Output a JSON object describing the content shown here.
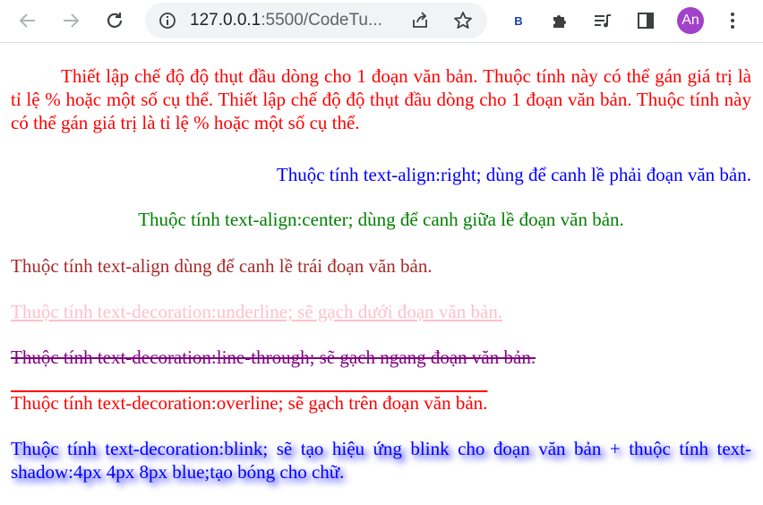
{
  "browser": {
    "url_host": "127.0.0.1",
    "url_rest": ":5500/CodeTu...",
    "ext_label": "B",
    "avatar_initials": "An",
    "icons": [
      "back-arrow-icon",
      "forward-arrow-icon",
      "reload-icon",
      "info-icon",
      "share-icon",
      "star-icon",
      "extension-b-icon",
      "puzzle-icon",
      "media-queue-icon",
      "side-panel-icon",
      "menu-dots-icon"
    ]
  },
  "paragraphs": {
    "indent": "Thiết lập chế độ độ thụt đầu dòng cho 1 đoạn văn bản. Thuộc tính này có thể gán giá trị là tỉ lệ % hoặc một số cụ thể. Thiết lập chế độ độ thụt đầu dòng cho 1 đoạn văn bản. Thuộc tính này có thể gán giá trị là tỉ lệ % hoặc một số cụ thể.",
    "right": "Thuộc tính text-align:right; dùng để canh lề phải đoạn văn bản.",
    "center": "Thuộc tính text-align:center; dùng để canh giữa lề đoạn văn bản.",
    "left": "Thuộc tính text-align dùng để canh lề trái đoạn văn bản.",
    "underline": "Thuộc tính text-decoration:underline; sẽ gạch dưới đoạn văn bản.",
    "line_through": "Thuộc tính text-decoration:line-through; sẽ gạch ngang đoạn văn bản.",
    "overline": "Thuộc tính text-decoration:overline; sẽ gạch trên đoạn văn bản.",
    "blink": "Thuộc tính text-decoration:blink; sẽ tạo hiệu ứng blink cho đoạn văn bản + thuộc tính text-shadow:4px 4px 8px blue;tạo bóng cho chữ."
  },
  "colors": {
    "indent": "#ff0000",
    "right": "#0000ff",
    "center": "#008000",
    "left": "#a52a2a",
    "underline": "#ffc0cb",
    "line_through": "#800080",
    "overline": "#ff0000",
    "blink": "#0000ff",
    "avatar": "#a142c8"
  }
}
